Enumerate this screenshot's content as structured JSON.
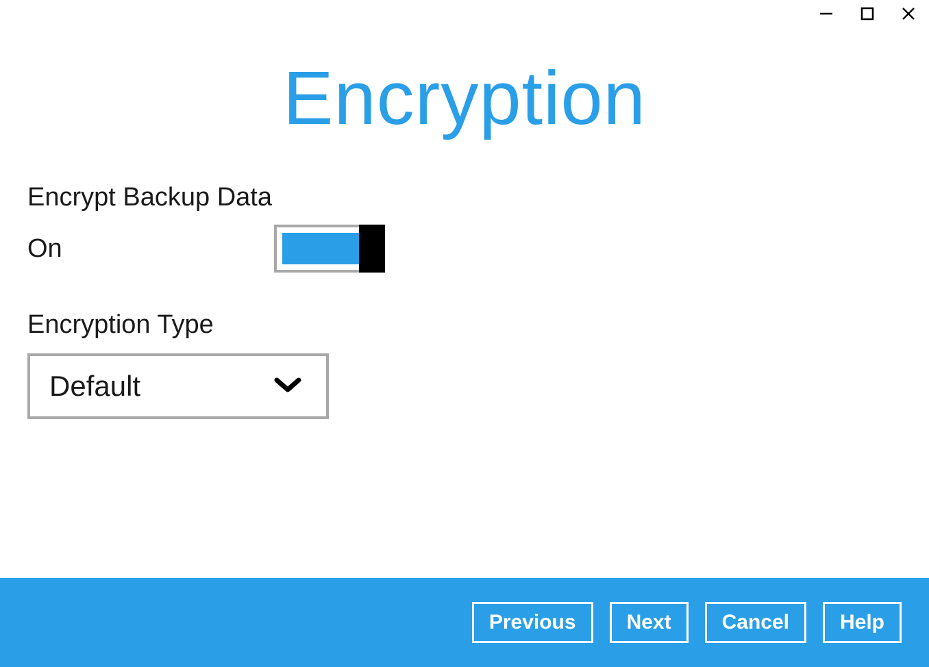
{
  "header": {
    "title": "Encryption"
  },
  "encrypt": {
    "label": "Encrypt Backup Data",
    "state": "On"
  },
  "type": {
    "label": "Encryption Type",
    "value": "Default"
  },
  "footer": {
    "previous": "Previous",
    "next": "Next",
    "cancel": "Cancel",
    "help": "Help"
  }
}
